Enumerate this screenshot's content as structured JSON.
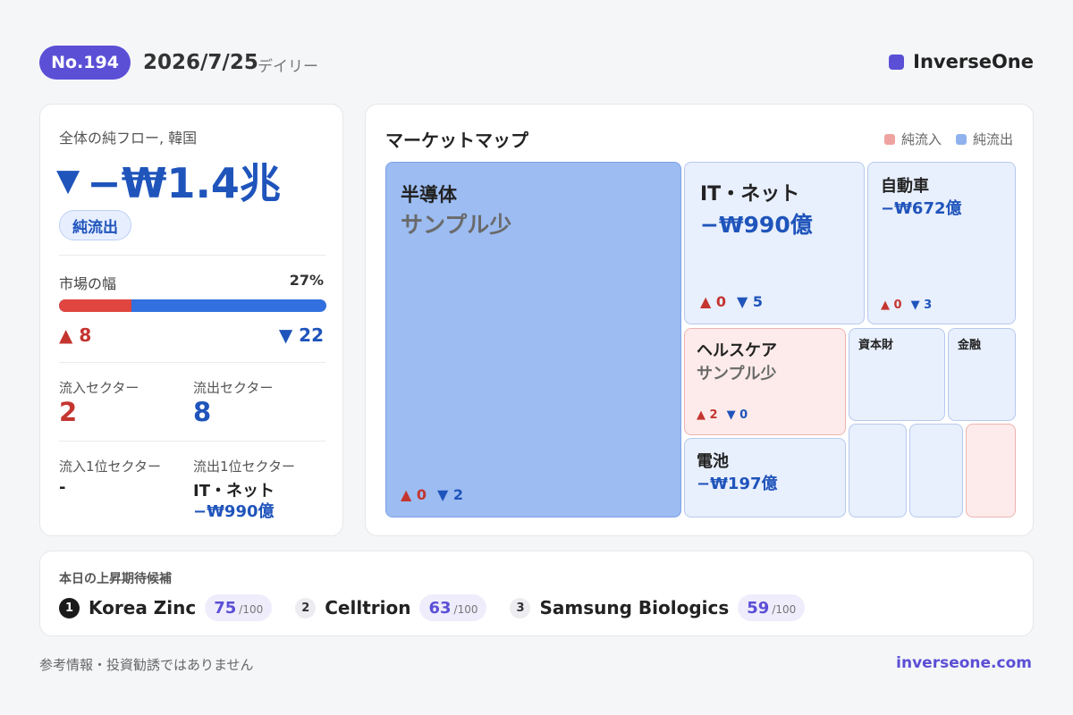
{
  "header": {
    "issue": "No.194",
    "date": "2026/7/25",
    "type": "デイリー",
    "brand": "InverseOne",
    "brand_color": "#5b4fd6"
  },
  "summary": {
    "label": "全体の純フロー, 韓国",
    "arrow": "▼",
    "value": "−₩1.4兆",
    "tag": "純流出",
    "breadth_label": "市場の幅",
    "breadth_pct": "27%",
    "breadth_fraction": 0.27,
    "up_count": "▲ 8",
    "down_count": "▼ 22",
    "inflow_sectors_label": "流入セクター",
    "inflow_sectors_value": "2",
    "outflow_sectors_label": "流出セクター",
    "outflow_sectors_value": "8",
    "top_inflow_label": "流入1位セクター",
    "top_inflow_value": "-",
    "top_outflow_label": "流出1位セクター",
    "top_outflow_name": "IT・ネット",
    "top_outflow_value": "−₩990億"
  },
  "market_map": {
    "title": "マーケットマップ",
    "legend": [
      {
        "label": "純流入",
        "color": "#eea3a0"
      },
      {
        "label": "純流出",
        "color": "#8fb2ee"
      }
    ],
    "tiles": {
      "semis": {
        "name": "半導体",
        "sub": "サンプル少",
        "up": "▲ 0",
        "down": "▼ 2"
      },
      "it": {
        "name": "IT・ネット",
        "value": "−₩990億",
        "up": "▲ 0",
        "down": "▼ 5"
      },
      "auto": {
        "name": "自動車",
        "value": "−₩672億",
        "up": "▲ 0",
        "down": "▼ 3"
      },
      "health": {
        "name": "ヘルスケア",
        "sub": "サンプル少",
        "up": "▲ 2",
        "down": "▼ 0"
      },
      "capital": {
        "name": "資本財"
      },
      "finance": {
        "name": "金融"
      },
      "battery": {
        "name": "電池",
        "value": "−₩197億"
      }
    }
  },
  "candidates": {
    "title": "本日の上昇期待候補",
    "items": [
      {
        "rank": "1",
        "name": "Korea Zinc",
        "score": "75",
        "max": "/100"
      },
      {
        "rank": "2",
        "name": "Celltrion",
        "score": "63",
        "max": "/100"
      },
      {
        "rank": "3",
        "name": "Samsung Biologics",
        "score": "59",
        "max": "/100"
      }
    ]
  },
  "footer": {
    "disclaimer": "参考情報・投資勧誘ではありません",
    "site": "inverseone.com"
  },
  "colors": {
    "inflow": "#c43530",
    "outflow": "#1f54bb",
    "accent": "#5b4fd6"
  }
}
